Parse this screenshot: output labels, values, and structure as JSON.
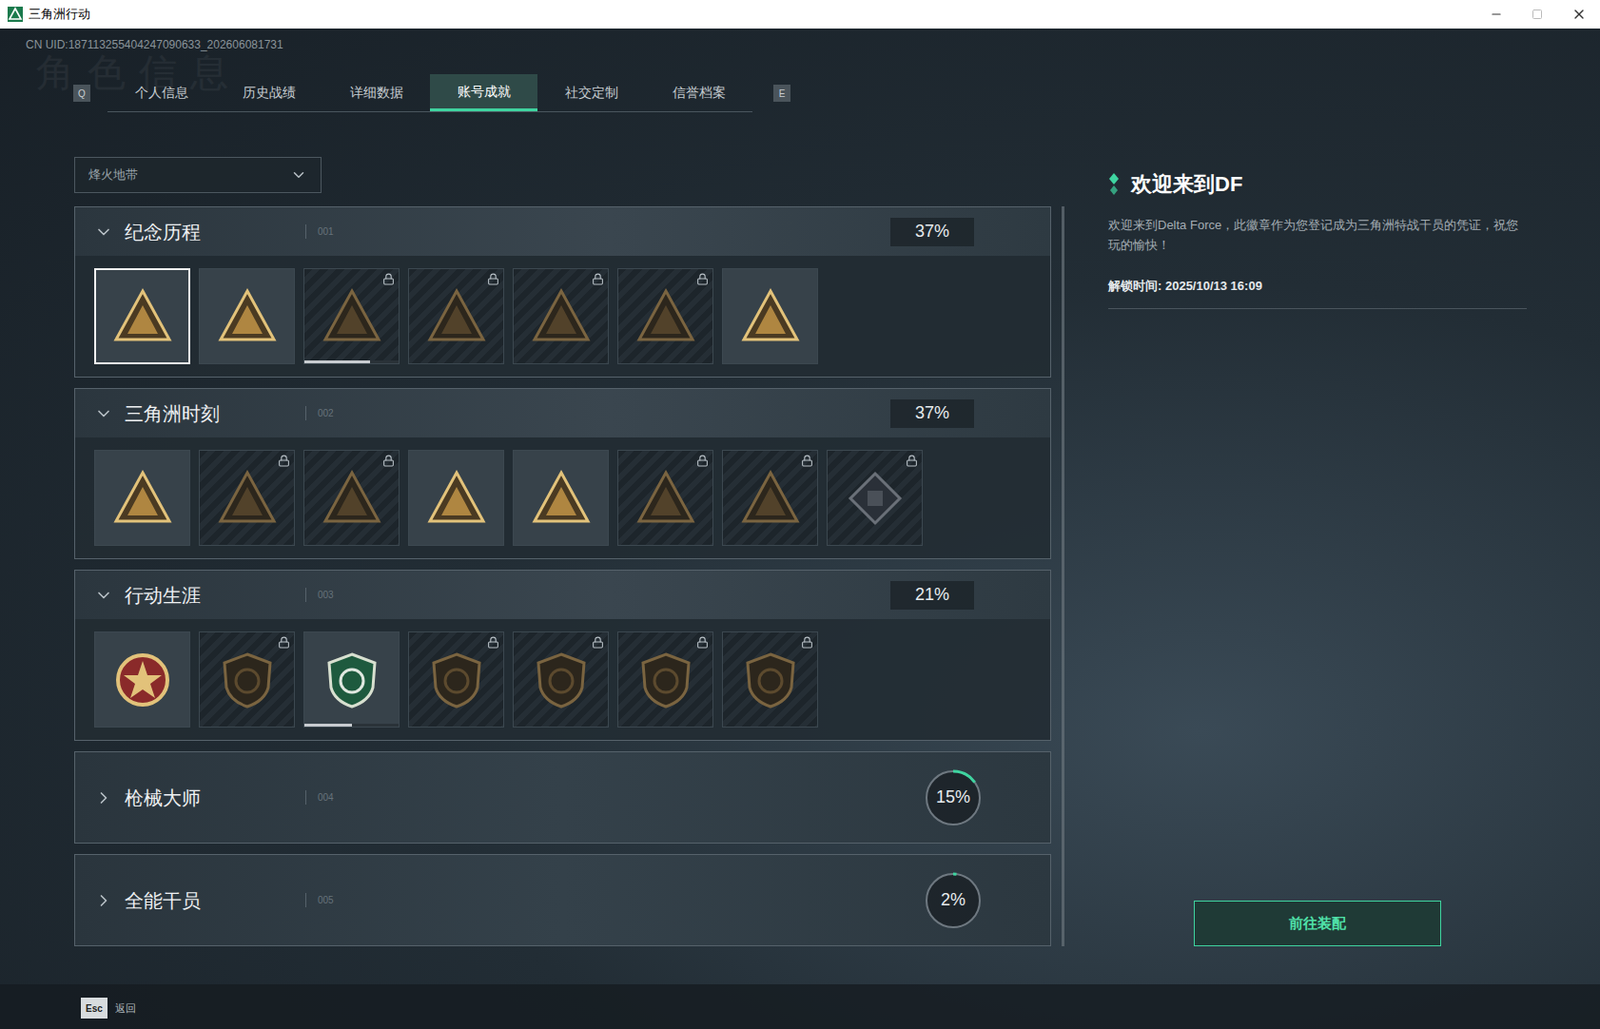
{
  "window": {
    "title": "三角洲行动"
  },
  "uid": "CN UID:187113255404247090633_202606081731",
  "watermark": "角色信息",
  "tab_keys": {
    "prev": "Q",
    "next": "E"
  },
  "tabs": [
    {
      "label": "个人信息",
      "selected": false
    },
    {
      "label": "历史战绩",
      "selected": false
    },
    {
      "label": "详细数据",
      "selected": false
    },
    {
      "label": "账号成就",
      "selected": true
    },
    {
      "label": "社交定制",
      "selected": false
    },
    {
      "label": "信誉档案",
      "selected": false
    }
  ],
  "mode_select": {
    "value": "烽火地带"
  },
  "sections": [
    {
      "title": "纪念历程",
      "code": "001",
      "percent": "37%",
      "expanded": true,
      "badges": [
        {
          "kind": "triangle",
          "unlocked": true,
          "selected": true
        },
        {
          "kind": "triangle",
          "unlocked": true,
          "selected": false
        },
        {
          "kind": "triangle",
          "unlocked": false,
          "selected": false,
          "level": 0.7
        },
        {
          "kind": "triangle",
          "unlocked": false,
          "selected": false
        },
        {
          "kind": "triangle",
          "unlocked": false,
          "selected": false
        },
        {
          "kind": "triangle",
          "unlocked": false,
          "selected": false
        },
        {
          "kind": "triangle",
          "unlocked": true,
          "selected": false
        }
      ]
    },
    {
      "title": "三角洲时刻",
      "code": "002",
      "percent": "37%",
      "expanded": true,
      "badges": [
        {
          "kind": "triangle",
          "unlocked": true,
          "selected": false
        },
        {
          "kind": "triangle",
          "unlocked": false,
          "selected": false
        },
        {
          "kind": "triangle",
          "unlocked": false,
          "selected": false
        },
        {
          "kind": "triangle",
          "unlocked": true,
          "selected": false
        },
        {
          "kind": "triangle",
          "unlocked": true,
          "selected": false
        },
        {
          "kind": "triangle",
          "unlocked": false,
          "selected": false
        },
        {
          "kind": "triangle",
          "unlocked": false,
          "selected": false
        },
        {
          "kind": "diamond",
          "unlocked": false,
          "selected": false
        }
      ]
    },
    {
      "title": "行动生涯",
      "code": "003",
      "percent": "21%",
      "expanded": true,
      "badges": [
        {
          "kind": "medal",
          "unlocked": true,
          "selected": false
        },
        {
          "kind": "shield",
          "unlocked": false,
          "selected": false
        },
        {
          "kind": "shield",
          "unlocked": true,
          "selected": false,
          "level": 0.5
        },
        {
          "kind": "shield",
          "unlocked": false,
          "selected": false
        },
        {
          "kind": "shield",
          "unlocked": false,
          "selected": false
        },
        {
          "kind": "shield",
          "unlocked": false,
          "selected": false
        },
        {
          "kind": "shield",
          "unlocked": false,
          "selected": false
        }
      ]
    },
    {
      "title": "枪械大师",
      "code": "004",
      "percent": "15%",
      "expanded": false,
      "level": 0.15,
      "badges": []
    },
    {
      "title": "全能干员",
      "code": "005",
      "percent": "2%",
      "expanded": false,
      "level": 0.02,
      "badges": []
    }
  ],
  "detail": {
    "title": "欢迎来到DF",
    "description": "欢迎来到Delta Force，此徽章作为您登记成为三角洲特战干员的凭证，祝您玩的愉快！",
    "unlock_time": "解锁时间: 2025/10/13 16:09",
    "button": "前往装配"
  },
  "footer": {
    "key": "Esc",
    "label": "返回"
  }
}
